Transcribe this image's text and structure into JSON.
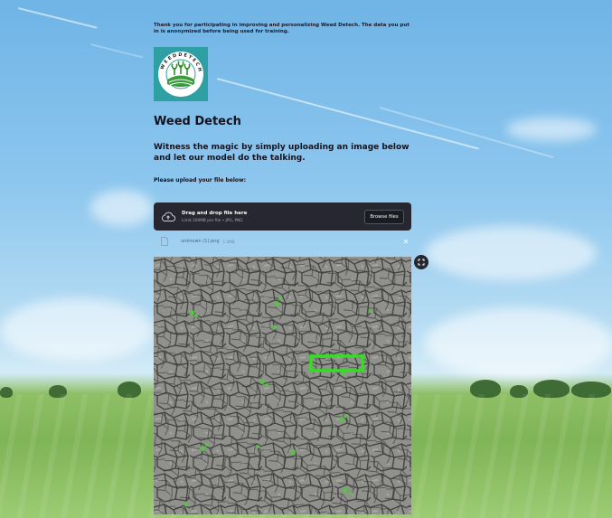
{
  "notice": {
    "text": "Thank you for participating in improving and personalizing Weed Detech. The data you put in is anonymized before being used for training."
  },
  "logo": {
    "ring_text": "WEED DETECH",
    "bg_color": "#2e9fa3"
  },
  "header": {
    "title": "Weed Detech",
    "subtitle": "Witness the magic by simply uploading an image below and let our model do the talking."
  },
  "uploader": {
    "label": "Please upload your file below:",
    "drop_text": "Drag and drop file here",
    "limit_text": "Limit 200MB per file • JPG, PNG",
    "browse_label": "Browse files",
    "icon": "cloud-upload-icon"
  },
  "uploaded_file": {
    "name": "unknown (1).png",
    "size": "1.4MB",
    "icon": "file-icon",
    "remove_icon": "close-icon"
  },
  "result_image": {
    "expand_icon": "fullscreen-icon",
    "detection_box_color": "#33e01f"
  },
  "colors": {
    "dropzone_bg": "#262730",
    "text_dark": "#131320"
  }
}
